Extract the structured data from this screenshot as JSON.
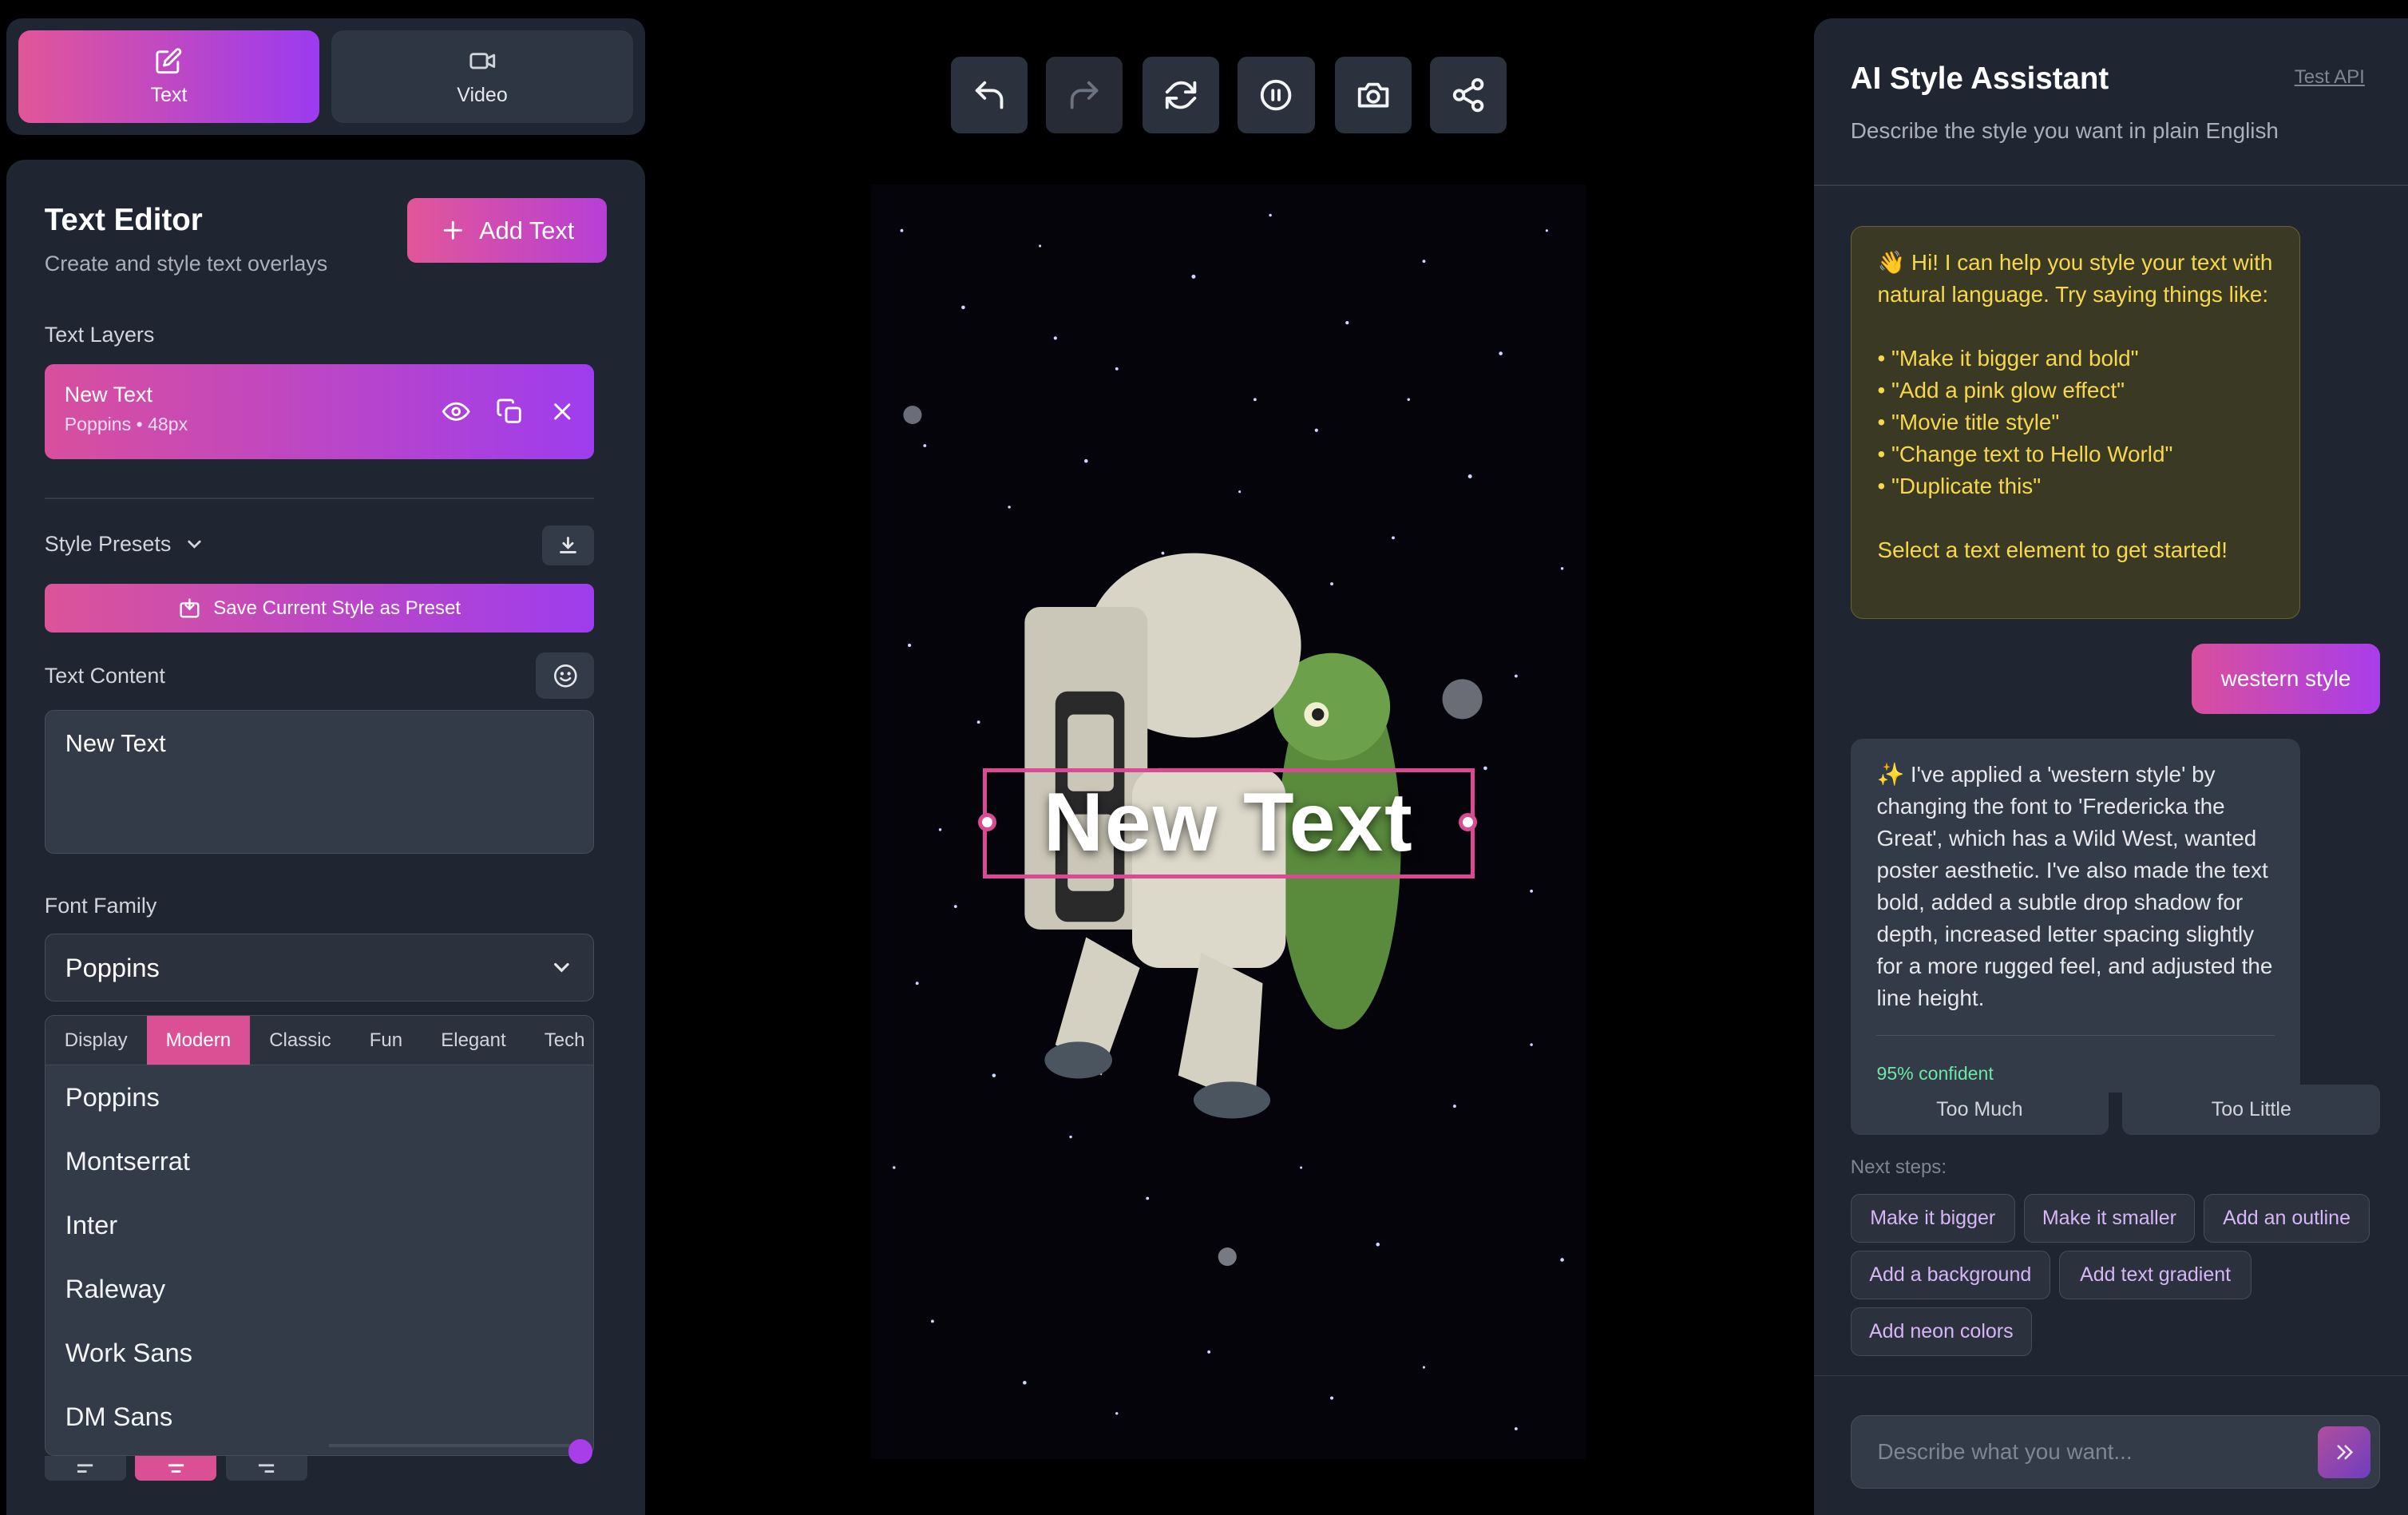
{
  "mode_tabs": [
    {
      "label": "Text",
      "icon": "edit-icon",
      "active": true
    },
    {
      "label": "Video",
      "icon": "video-camera-icon",
      "active": false
    }
  ],
  "editor": {
    "title": "Text Editor",
    "subtitle": "Create and style text overlays",
    "add_text_label": "Add Text",
    "layers_label": "Text Layers",
    "layer": {
      "name": "New Text",
      "meta": "Poppins • 48px"
    },
    "presets_label": "Style Presets",
    "save_preset_label": "Save Current Style as Preset",
    "content_label": "Text Content",
    "content_value": "New Text",
    "font_family_label": "Font Family",
    "font_family_value": "Poppins",
    "font_categories": [
      "Display",
      "Modern",
      "Classic",
      "Fun",
      "Elegant",
      "Tech"
    ],
    "active_category": "Modern",
    "font_options": [
      "Poppins",
      "Montserrat",
      "Inter",
      "Raleway",
      "Work Sans",
      "DM Sans"
    ]
  },
  "toolbar": [
    {
      "name": "undo-button",
      "icon": "undo-icon"
    },
    {
      "name": "redo-button",
      "icon": "redo-icon",
      "disabled": true
    },
    {
      "name": "refresh-button",
      "icon": "refresh-icon"
    },
    {
      "name": "pause-button",
      "icon": "pause-icon"
    },
    {
      "name": "snapshot-button",
      "icon": "camera-icon"
    },
    {
      "name": "share-button",
      "icon": "share-icon"
    }
  ],
  "canvas": {
    "text": "New Text"
  },
  "assistant": {
    "title": "AI Style Assistant",
    "test_api_label": "Test API",
    "subtitle": "Describe the style you want in plain English",
    "intro_message": "👋 Hi! I can help you style your text with natural language. Try saying things like:\n\n• \"Make it bigger and bold\"\n• \"Add a pink glow effect\"\n• \"Movie title style\"\n• \"Change text to Hello World\"\n• \"Duplicate this\"\n\nSelect a text element to get started!",
    "user_message": "western style",
    "ai_message": "✨ I've applied a 'western style' by changing the font to 'Fredericka the Great', which has a Wild West, wanted poster aesthetic. I've also made the text bold, added a subtle drop shadow for depth, increased letter spacing slightly for a more rugged feel, and adjusted the line height.",
    "confidence": "95% confident",
    "too_much_label": "Too Much",
    "too_little_label": "Too Little",
    "next_steps_label": "Next steps:",
    "next_steps": [
      "Make it bigger",
      "Make it smaller",
      "Add an outline",
      "Add a background",
      "Add text gradient",
      "Add neon colors"
    ],
    "input_placeholder": "Describe what you want..."
  },
  "colors": {
    "accent_pink": "#e25698",
    "accent_purple": "#9b3bf0",
    "panel": "#1f2531",
    "intro_text": "#f7d84c",
    "confidence": "#6ee7a3"
  }
}
